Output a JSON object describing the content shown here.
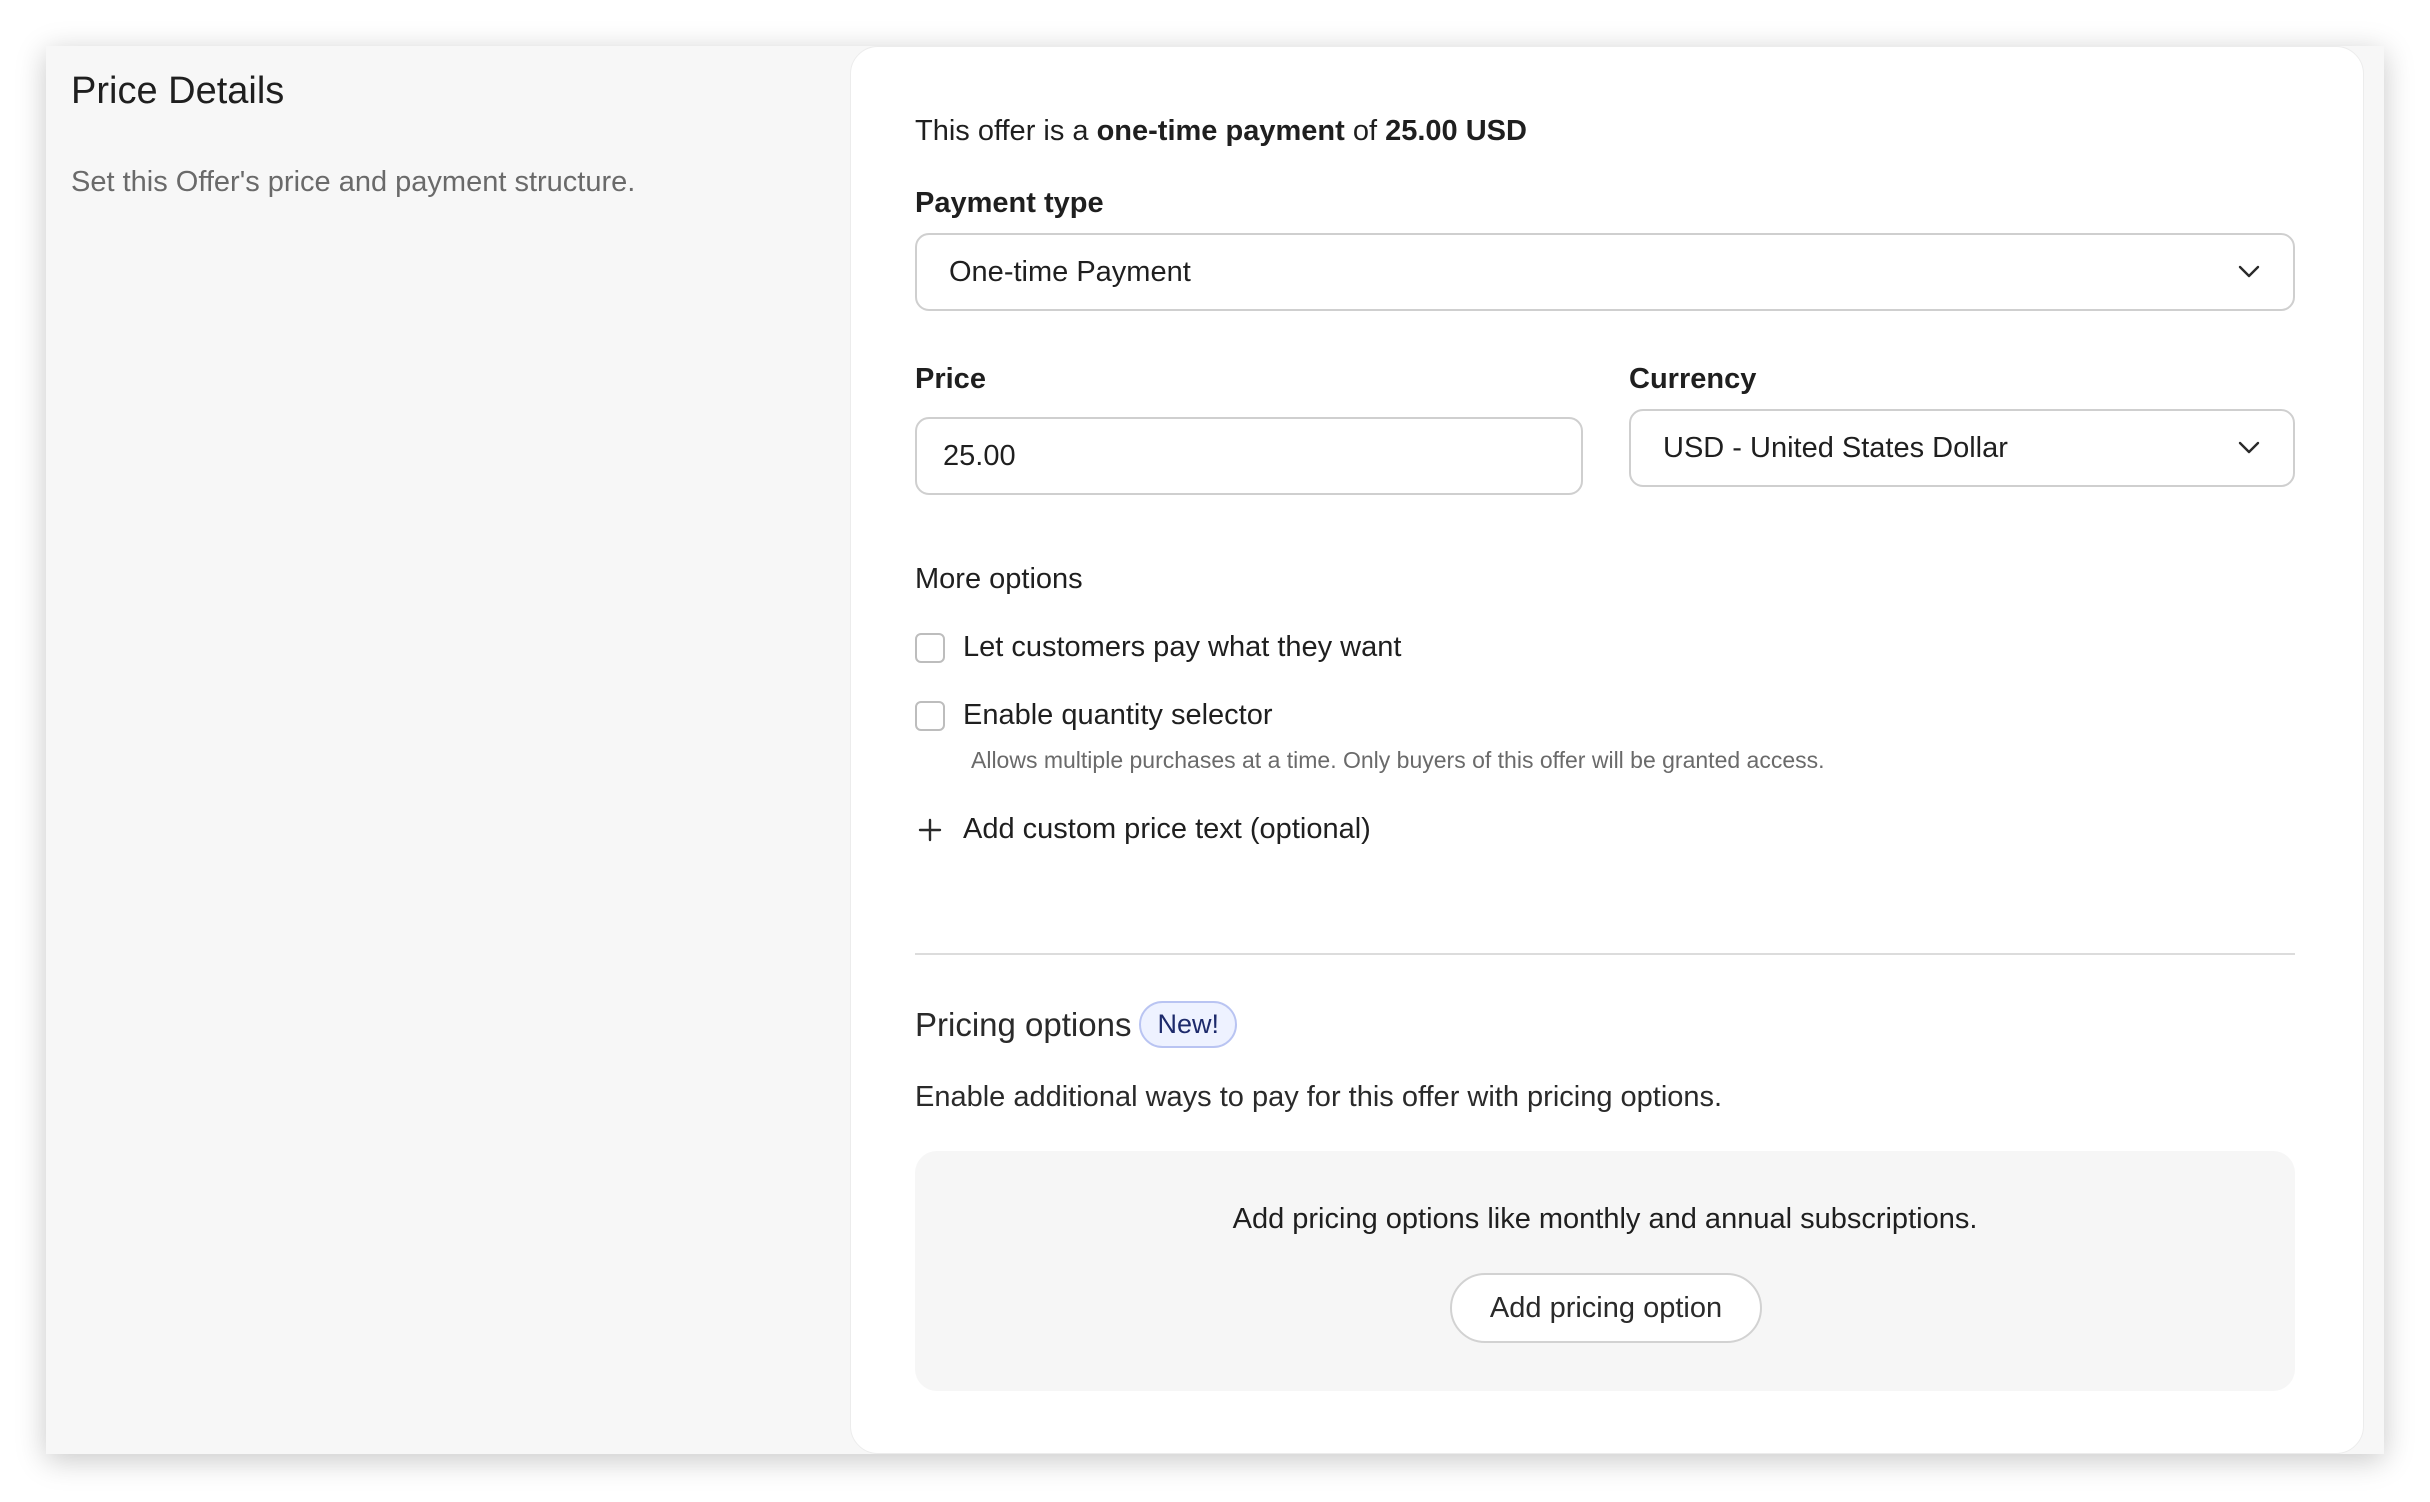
{
  "sidebar": {
    "title": "Price Details",
    "subtitle": "Set this Offer's price and payment structure."
  },
  "summary": {
    "prefix": "This offer is a ",
    "payment_kind": "one-time payment",
    "middle": " of ",
    "amount": "25.00 USD"
  },
  "payment_type": {
    "label": "Payment type",
    "value": "One-time Payment",
    "icon": "chevron-down-icon"
  },
  "price": {
    "label": "Price",
    "value": "25.00"
  },
  "currency": {
    "label": "Currency",
    "value": "USD - United States Dollar",
    "icon": "chevron-down-icon"
  },
  "more_options": {
    "heading": "More options",
    "pay_what_you_want": {
      "label": "Let customers pay what they want",
      "checked": false
    },
    "quantity_selector": {
      "label": "Enable quantity selector",
      "checked": false,
      "help": "Allows multiple purchases at a time. Only buyers of this offer will be granted access."
    },
    "custom_price_text": {
      "label": "Add custom price text (optional)",
      "icon": "plus-icon"
    }
  },
  "pricing_options": {
    "title": "Pricing options",
    "badge": "New!",
    "description": "Enable additional ways to pay for this offer with pricing options.",
    "empty_message": "Add pricing options like monthly and annual subscriptions.",
    "add_button_label": "Add pricing option"
  },
  "colors": {
    "page_bg": "#f7f7f7",
    "card_bg": "#ffffff",
    "badge_bg": "#eef2ff",
    "badge_border": "#b9c4f2",
    "badge_text": "#1d2a6b",
    "muted_text": "#6a6a6a"
  }
}
